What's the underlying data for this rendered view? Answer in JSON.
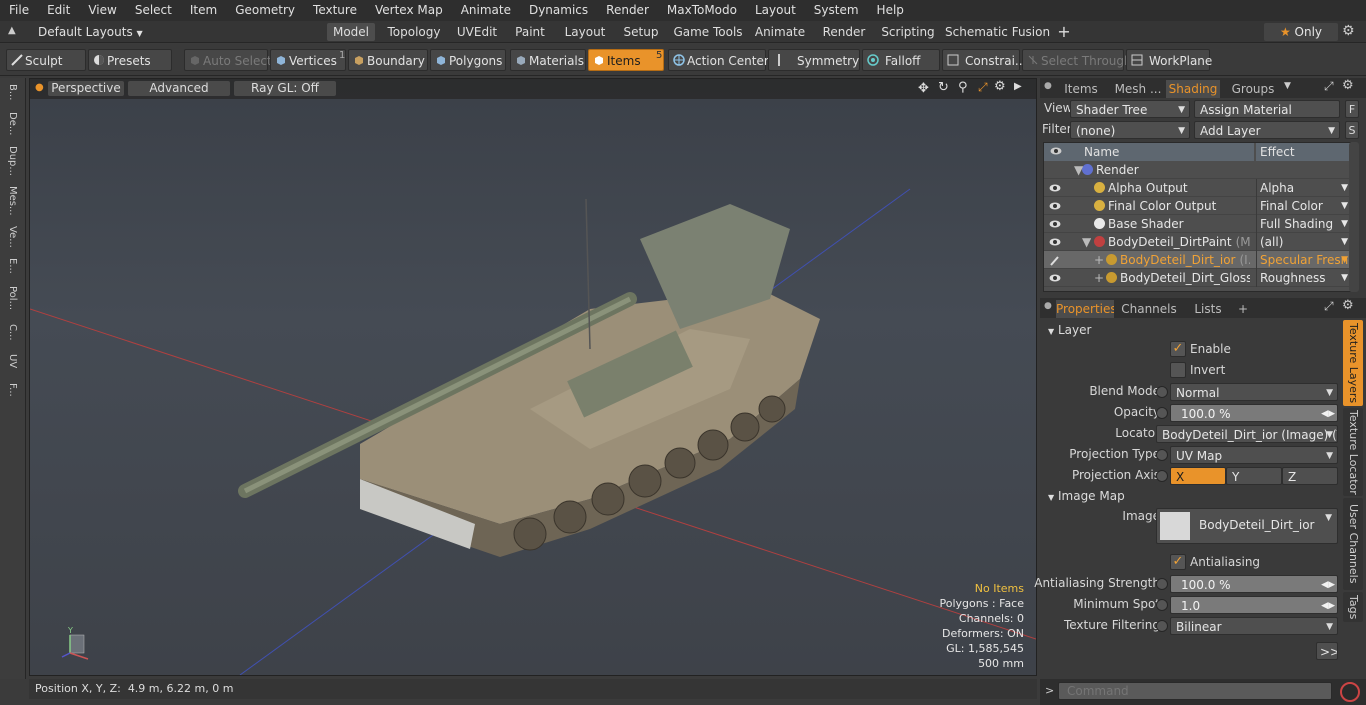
{
  "menubar": [
    "File",
    "Edit",
    "View",
    "Select",
    "Item",
    "Geometry",
    "Texture",
    "Vertex Map",
    "Animate",
    "Dynamics",
    "Render",
    "MaxToModo",
    "Layout",
    "System",
    "Help"
  ],
  "layoutbar": {
    "layouts_label": "Default Layouts",
    "tabs": [
      "Model",
      "Topology",
      "UVEdit",
      "Paint",
      "Layout",
      "Setup",
      "Game Tools",
      "Animate",
      "Render",
      "Scripting",
      "Schematic Fusion"
    ],
    "active_tab": "Model",
    "add_label": "+",
    "only_label": "Only"
  },
  "toolbar": {
    "sculpt": "Sculpt",
    "presets": "Presets",
    "auto_select": "Auto Select",
    "vertices": "Vertices",
    "vertices_count": "1",
    "boundary": "Boundary",
    "polygons": "Polygons",
    "materials": "Materials",
    "items": "Items",
    "items_count": "5",
    "action_center": "Action Center",
    "symmetry": "Symmetry",
    "falloff": "Falloff",
    "constraints": "Constrai...",
    "select_through": "Select Through",
    "workplane": "WorkPlane"
  },
  "left_tabs": [
    "B...",
    "De...",
    "Dup...",
    "Mes...",
    "Ve...",
    "E...",
    "Pol...",
    "C...",
    "UV",
    "F..."
  ],
  "viewport": {
    "view_mode": "Perspective",
    "shading": "Advanced",
    "raygl": "Ray GL: Off",
    "hud": {
      "items": "No Items",
      "polygons": "Polygons : Face",
      "channels": "Channels: 0",
      "deformers": "Deformers: ON",
      "gl": "GL: 1,585,545",
      "scale": "500 mm"
    },
    "axis_labels": {
      "y": "Y"
    }
  },
  "statusbar": {
    "label": "Position X, Y, Z:",
    "value": "4.9 m, 6.22 m, 0 m"
  },
  "top_panel": {
    "tabs": [
      "Items",
      "Mesh ...",
      "Shading",
      "Groups"
    ],
    "active_tab": "Shading",
    "view_label": "View",
    "view_value": "Shader Tree",
    "assign_material": "Assign Material",
    "f_button": "F",
    "filter_label": "Filter",
    "filter_value": "(none)",
    "add_layer": "Add Layer",
    "s_button": "S",
    "columns": {
      "name": "Name",
      "effect": "Effect"
    },
    "rows": [
      {
        "name": "Render",
        "effect": "",
        "icon": "render-sphere-icon"
      },
      {
        "name": "Alpha Output",
        "effect": "Alpha",
        "icon": "output-icon"
      },
      {
        "name": "Final Color Output",
        "effect": "Final Color",
        "icon": "output-icon"
      },
      {
        "name": "Base Shader",
        "effect": "Full Shading",
        "icon": "shader-sphere-icon"
      },
      {
        "name": "BodyDeteil_DirtPaint",
        "suffix": "(M ...",
        "effect": "(all)",
        "icon": "material-group-icon"
      },
      {
        "name": "BodyDeteil_Dirt_ior",
        "suffix": "(I...",
        "effect": "Specular Fresnel",
        "icon": "image-layer-icon"
      },
      {
        "name": "BodyDeteil_Dirt_Gloss...",
        "effect": "Roughness",
        "icon": "image-layer-icon"
      }
    ]
  },
  "properties_panel": {
    "tabs": [
      "Properties",
      "Channels",
      "Lists"
    ],
    "active_tab": "Properties",
    "add_label": "+",
    "section_layer": "Layer",
    "enable": "Enable",
    "invert": "Invert",
    "blend_mode_label": "Blend Mode",
    "blend_mode": "Normal",
    "opacity_label": "Opacity",
    "opacity": "100.0 %",
    "locator_label": "Locator",
    "locator": "BodyDeteil_Dirt_ior (Image) (Te...",
    "projection_type_label": "Projection Type",
    "projection_type": "UV Map",
    "projection_axis_label": "Projection Axis",
    "axis_x": "X",
    "axis_y": "Y",
    "axis_z": "Z",
    "section_image_map": "Image Map",
    "image_label": "Image",
    "image_value": "BodyDeteil_Dirt_ior",
    "antialiasing": "Antialiasing",
    "aa_strength_label": "Antialiasing Strength",
    "aa_strength": "100.0 %",
    "min_spot_label": "Minimum Spot",
    "min_spot": "1.0",
    "tex_filter_label": "Texture Filtering",
    "tex_filter": "Bilinear",
    "more_button": ">>",
    "side_tabs": [
      "Texture Layers",
      "Texture Locator",
      "User Channels",
      "Tags"
    ]
  },
  "command": {
    "placeholder": "Command"
  },
  "colors": {
    "accent": "#e9932a",
    "selected_text": "#f0a236"
  }
}
